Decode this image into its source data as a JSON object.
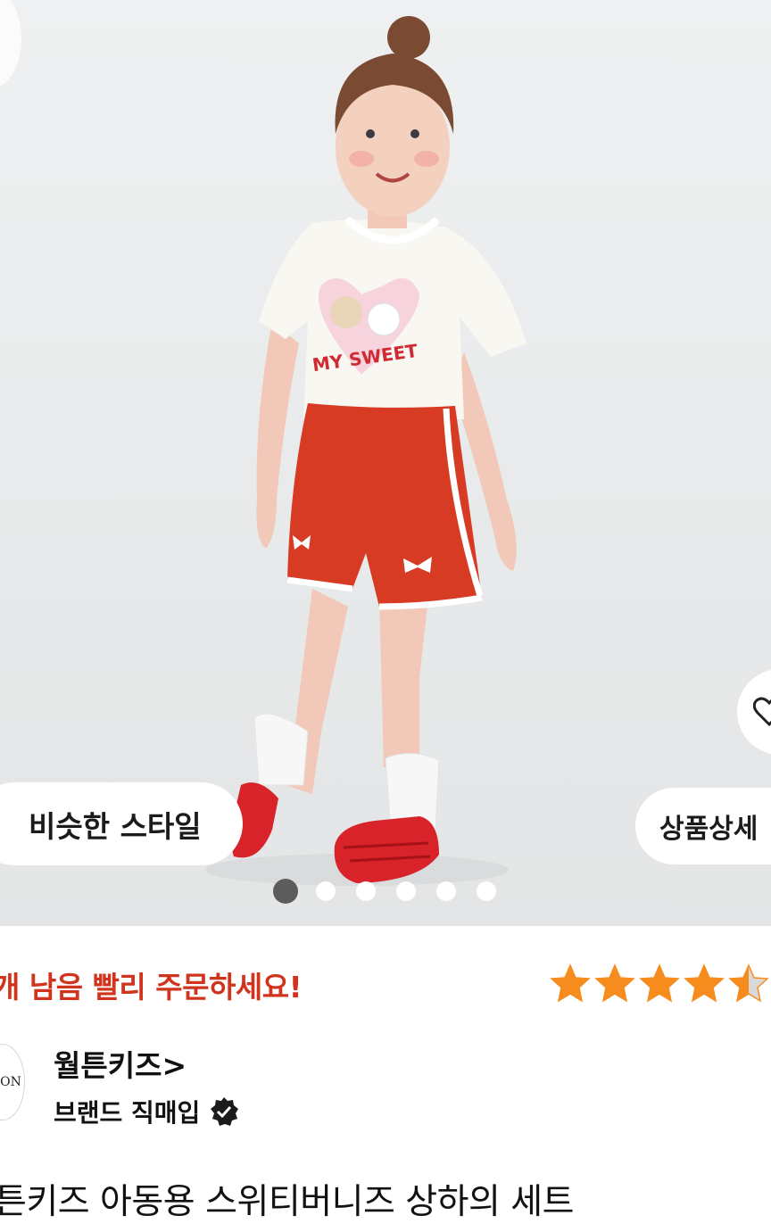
{
  "hero": {
    "similar_style_label": "비슷한 스타일",
    "detail_label": "상품상세",
    "shirt_print_text": "MY SWEET",
    "carousel": {
      "total": 6,
      "active_index": 0
    }
  },
  "info": {
    "stock_message": "개 남음 빨리 주문하세요!",
    "rating": {
      "value": 4.5,
      "max": 5
    },
    "colors": {
      "stock_text": "#d0341c",
      "star": "#f68b1e",
      "star_empty": "#d9d9d9"
    }
  },
  "brand": {
    "logo_text": "ON",
    "name": "월튼키즈>",
    "badge_label": "브랜드 직매입"
  },
  "product": {
    "title": "튼키즈 아동용 스위티버니즈 상하의 세트"
  },
  "icons": [
    "scan-icon",
    "heart-icon",
    "verified-check-icon",
    "star-icon"
  ]
}
